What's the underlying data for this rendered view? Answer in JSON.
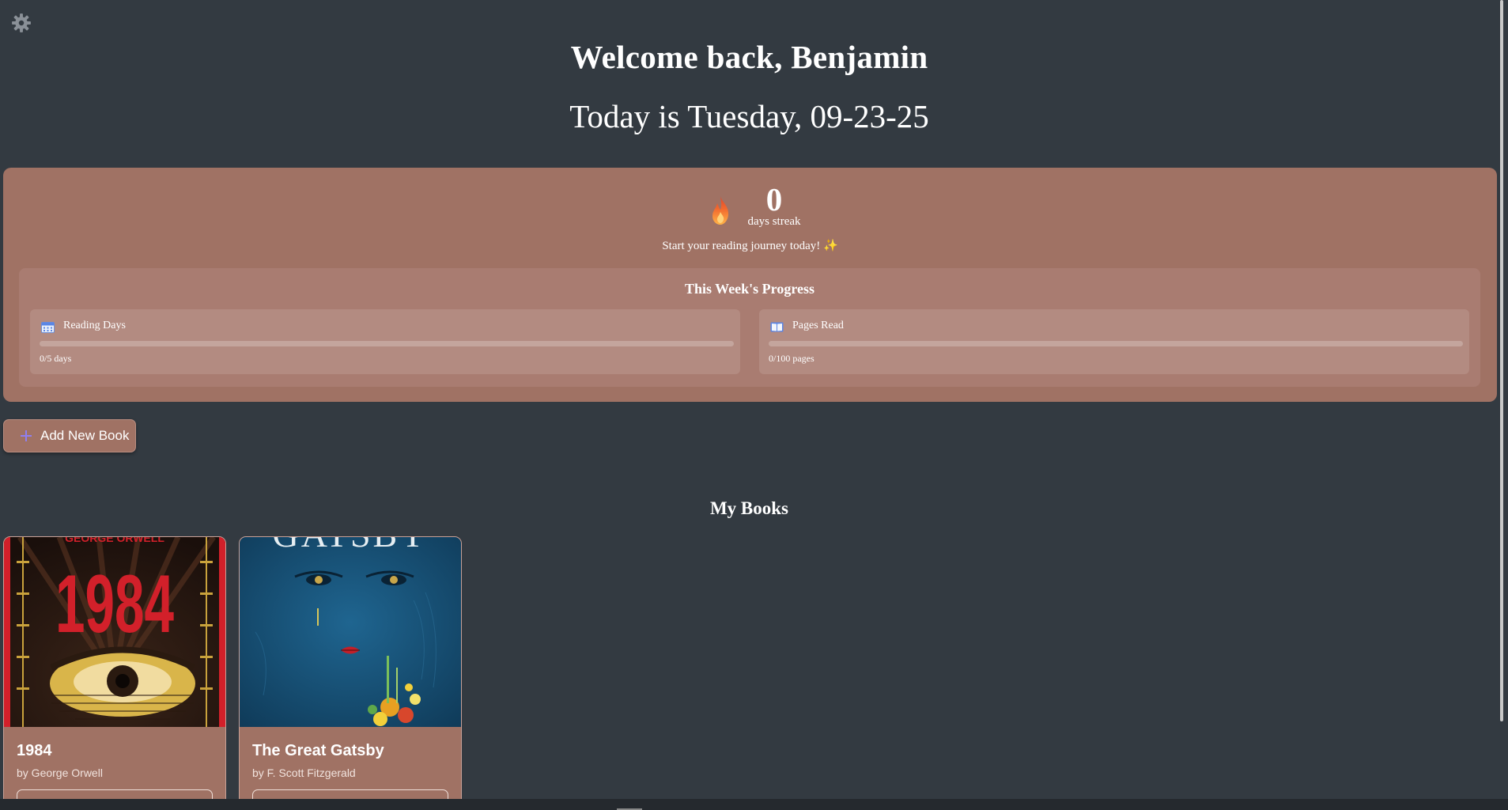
{
  "header": {
    "settings_icon": "gear-icon",
    "welcome": "Welcome back, Benjamin",
    "date_line": "Today is Tuesday, 09-23-25"
  },
  "streak": {
    "icon": "flame-icon",
    "count": "0",
    "label": "days streak",
    "message": "Start your reading journey today! ✨"
  },
  "weekly_progress": {
    "title": "This Week's Progress",
    "cards": [
      {
        "icon": "calendar-icon",
        "label": "Reading Days",
        "value_text": "0/5 days",
        "progress": 0
      },
      {
        "icon": "book-icon",
        "label": "Pages Read",
        "value_text": "0/100 pages",
        "progress": 0
      }
    ]
  },
  "add_book": {
    "icon": "plus-icon",
    "label": "Add New Book"
  },
  "library": {
    "title": "My Books",
    "books": [
      {
        "title": "1984",
        "author": "by George Orwell",
        "cover_text": "1984",
        "cover_header": "GEORGE ORWELL"
      },
      {
        "title": "The Great Gatsby",
        "author": "by F. Scott Fitzgerald",
        "cover_text": "GATSBY"
      }
    ]
  },
  "colors": {
    "background": "#333a41",
    "panel": "#a07264",
    "progress_panel": "#a97c71",
    "progress_card": "#b38b81",
    "accent_red": "#d2202a"
  }
}
